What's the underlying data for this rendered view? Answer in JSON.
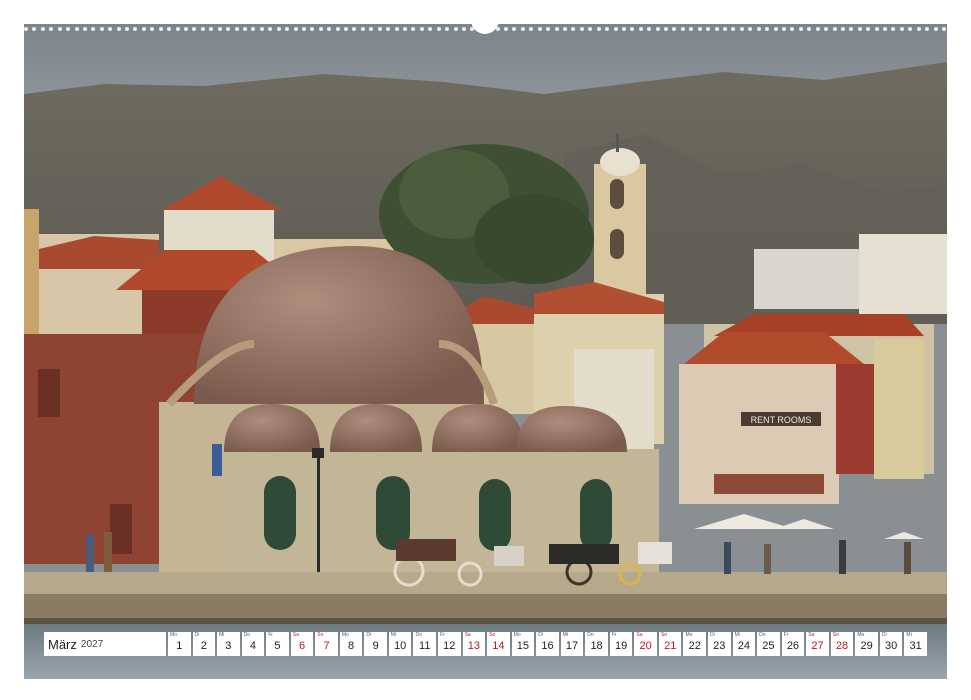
{
  "calendar": {
    "month": "März",
    "year": "2027",
    "days": [
      {
        "wd": "Mo",
        "num": "1",
        "weekend": false
      },
      {
        "wd": "Di",
        "num": "2",
        "weekend": false
      },
      {
        "wd": "Mi",
        "num": "3",
        "weekend": false
      },
      {
        "wd": "Do",
        "num": "4",
        "weekend": false
      },
      {
        "wd": "Fr",
        "num": "5",
        "weekend": false
      },
      {
        "wd": "Sa",
        "num": "6",
        "weekend": true
      },
      {
        "wd": "So",
        "num": "7",
        "weekend": true
      },
      {
        "wd": "Mo",
        "num": "8",
        "weekend": false
      },
      {
        "wd": "Di",
        "num": "9",
        "weekend": false
      },
      {
        "wd": "Mi",
        "num": "10",
        "weekend": false
      },
      {
        "wd": "Do",
        "num": "11",
        "weekend": false
      },
      {
        "wd": "Fr",
        "num": "12",
        "weekend": false
      },
      {
        "wd": "Sa",
        "num": "13",
        "weekend": true
      },
      {
        "wd": "So",
        "num": "14",
        "weekend": true
      },
      {
        "wd": "Mo",
        "num": "15",
        "weekend": false
      },
      {
        "wd": "Di",
        "num": "16",
        "weekend": false
      },
      {
        "wd": "Mi",
        "num": "17",
        "weekend": false
      },
      {
        "wd": "Do",
        "num": "18",
        "weekend": false
      },
      {
        "wd": "Fr",
        "num": "19",
        "weekend": false
      },
      {
        "wd": "Sa",
        "num": "20",
        "weekend": true
      },
      {
        "wd": "So",
        "num": "21",
        "weekend": true
      },
      {
        "wd": "Mo",
        "num": "22",
        "weekend": false
      },
      {
        "wd": "Di",
        "num": "23",
        "weekend": false
      },
      {
        "wd": "Mi",
        "num": "24",
        "weekend": false
      },
      {
        "wd": "Do",
        "num": "25",
        "weekend": false
      },
      {
        "wd": "Fr",
        "num": "26",
        "weekend": false
      },
      {
        "wd": "Sa",
        "num": "27",
        "weekend": true
      },
      {
        "wd": "So",
        "num": "28",
        "weekend": true
      },
      {
        "wd": "Mo",
        "num": "29",
        "weekend": false
      },
      {
        "wd": "Di",
        "num": "30",
        "weekend": false
      },
      {
        "wd": "Mi",
        "num": "31",
        "weekend": false
      }
    ]
  },
  "photo": {
    "sign_text": "RENT ROOMS"
  },
  "colors": {
    "weekend": "#c4161c",
    "weekday": "#222222"
  }
}
